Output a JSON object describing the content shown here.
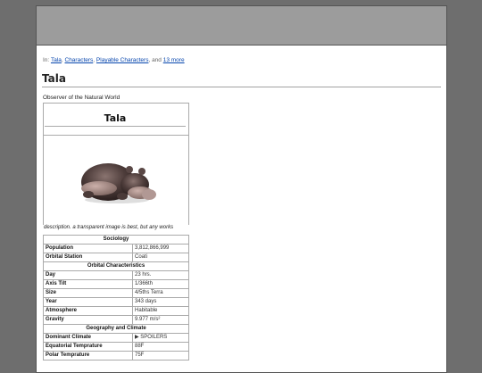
{
  "categories": {
    "prefix": "In:",
    "links": [
      "Tala",
      "Characters",
      "Playable Characters"
    ],
    "sep1": ",",
    "sep2": ",",
    "sep3": ", and",
    "more": "13 more"
  },
  "page_title": "Tala",
  "subtitle": "Observer of the Natural World",
  "infobox": {
    "title": "Tala",
    "image_icon": "hippo-figure-image",
    "caption": "description. a transparent image is best, but any works",
    "sections": [
      {
        "heading": "Sociology",
        "rows": [
          {
            "label": "Population",
            "value": "3,812,866,999"
          },
          {
            "label": "Orbital Station",
            "value": "Coati"
          }
        ]
      },
      {
        "heading": "Orbital Characteristics",
        "rows": [
          {
            "label": "Day",
            "value": "23 hrs."
          },
          {
            "label": "Axis Tilt",
            "value": "1/366th"
          },
          {
            "label": "Size",
            "value": "4/5ths Terra"
          },
          {
            "label": "Year",
            "value": "343 days"
          },
          {
            "label": "Atmosphere",
            "value": "Habitable"
          },
          {
            "label": "Gravity",
            "value": "9.977 m/s²"
          }
        ]
      },
      {
        "heading": "Geography and Climate",
        "rows": [
          {
            "label": "Dominant Climate",
            "value": "▶ SPOILERS"
          },
          {
            "label": "Equatorial Temprature",
            "value": "88F"
          },
          {
            "label": "Polar Temprature",
            "value": "75F"
          }
        ]
      }
    ]
  }
}
